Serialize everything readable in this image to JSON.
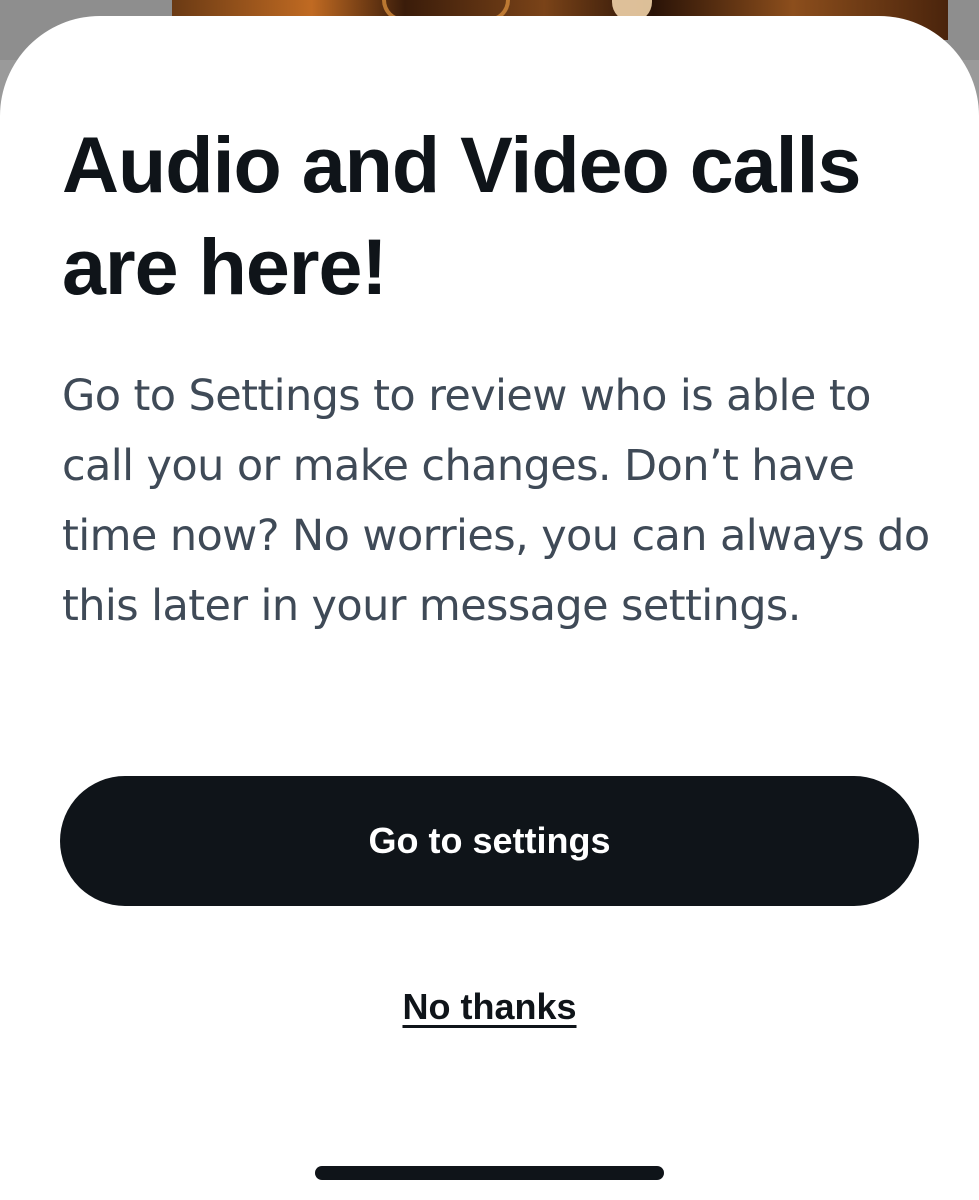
{
  "dialog": {
    "title": "Audio and Video calls are here!",
    "body": "Go to Settings to review who is able to call you or make changes. Don’t have time now? No worries, you can always do this later in your message settings.",
    "primary_button_label": "Go to settings",
    "secondary_link_label": "No thanks"
  },
  "colors": {
    "text_primary": "#0f1419",
    "text_secondary": "#3f4a57",
    "button_background": "#0f1419",
    "button_text": "#ffffff",
    "sheet_background": "#ffffff"
  }
}
